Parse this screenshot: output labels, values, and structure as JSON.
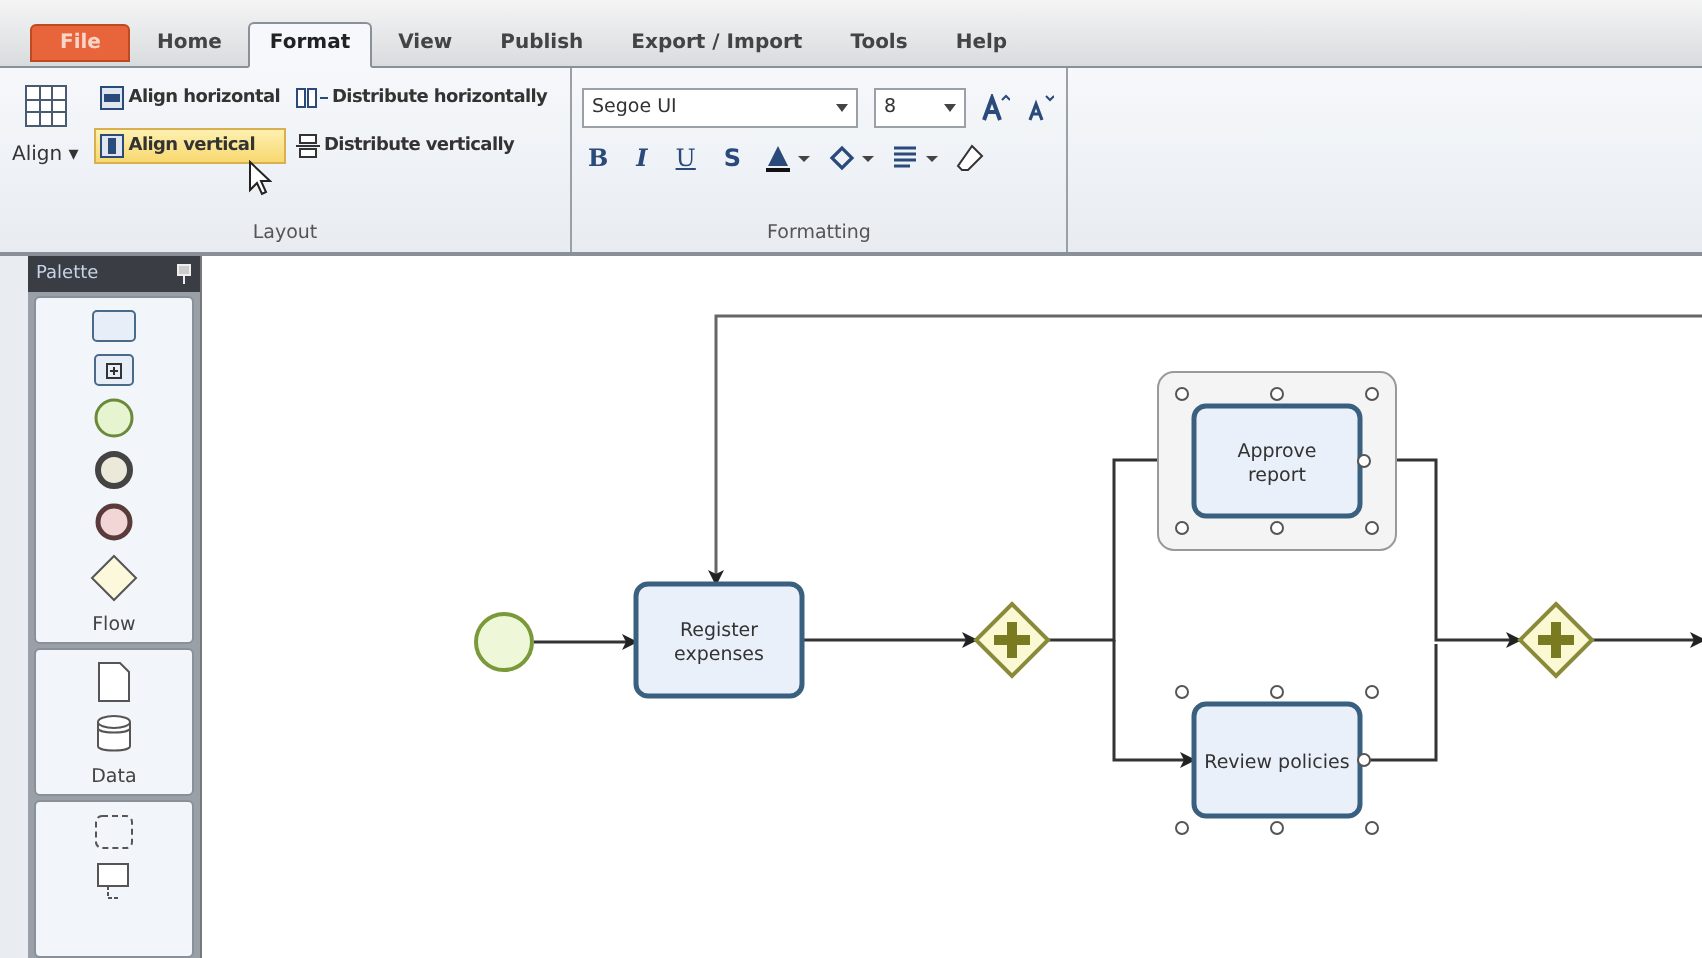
{
  "tabs": [
    {
      "label": "File",
      "kind": "file",
      "selected": false
    },
    {
      "label": "Home",
      "kind": "tab",
      "selected": false
    },
    {
      "label": "Format",
      "kind": "tab",
      "selected": true
    },
    {
      "label": "View",
      "kind": "tab",
      "selected": false
    },
    {
      "label": "Publish",
      "kind": "tab",
      "selected": false
    },
    {
      "label": "Export / Import",
      "kind": "tab",
      "selected": false
    },
    {
      "label": "Tools",
      "kind": "tab",
      "selected": false
    },
    {
      "label": "Help",
      "kind": "tab",
      "selected": false
    }
  ],
  "layout_group": {
    "title": "Layout",
    "align_button": "Align ▾",
    "buttons": [
      {
        "label": "Align horizontal",
        "highlighted": false
      },
      {
        "label": "Distribute horizontally",
        "highlighted": false
      },
      {
        "label": "Align vertical",
        "highlighted": true
      },
      {
        "label": "Distribute vertically",
        "highlighted": false
      }
    ]
  },
  "formatting_group": {
    "title": "Formatting",
    "font": "Segoe UI",
    "size": "8",
    "style_buttons": [
      "B",
      "I",
      "U",
      "S"
    ]
  },
  "palette": {
    "title": "Palette",
    "sections": [
      {
        "label": "Flow"
      },
      {
        "label": "Data"
      }
    ]
  },
  "diagram": {
    "nodes": [
      {
        "kind": "start",
        "selected": false
      },
      {
        "kind": "task",
        "lines": [
          "Register",
          "expenses"
        ],
        "selected": false
      },
      {
        "kind": "gateway",
        "selected": false
      },
      {
        "kind": "task",
        "lines": [
          "Approve",
          "report"
        ],
        "selected": true
      },
      {
        "kind": "task",
        "lines": [
          "Review policies"
        ],
        "selected": true
      },
      {
        "kind": "gateway",
        "selected": false
      }
    ]
  }
}
